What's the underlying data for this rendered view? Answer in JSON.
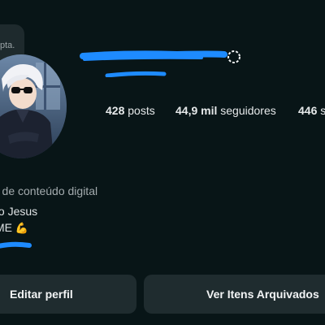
{
  "note": {
    "text": "pta."
  },
  "profile": {
    "username_redacted": true
  },
  "stats": {
    "posts": {
      "count": "428",
      "label": "posts"
    },
    "followers": {
      "count": "44,9 mil",
      "label": "seguidores"
    },
    "following": {
      "count": "446",
      "label": "s"
    }
  },
  "bio": {
    "category": ") de conteúdo digital",
    "line2": "to Jesus",
    "line3_text": "ME",
    "line3_emoji": "💪"
  },
  "buttons": {
    "edit_profile": "Editar perfil",
    "archived_items": "Ver Itens Arquivados"
  },
  "colors": {
    "background": "#081517",
    "button_bg": "#1f2c2f",
    "redaction_blue": "#1e8bff",
    "secondary_text": "#a3abae"
  }
}
